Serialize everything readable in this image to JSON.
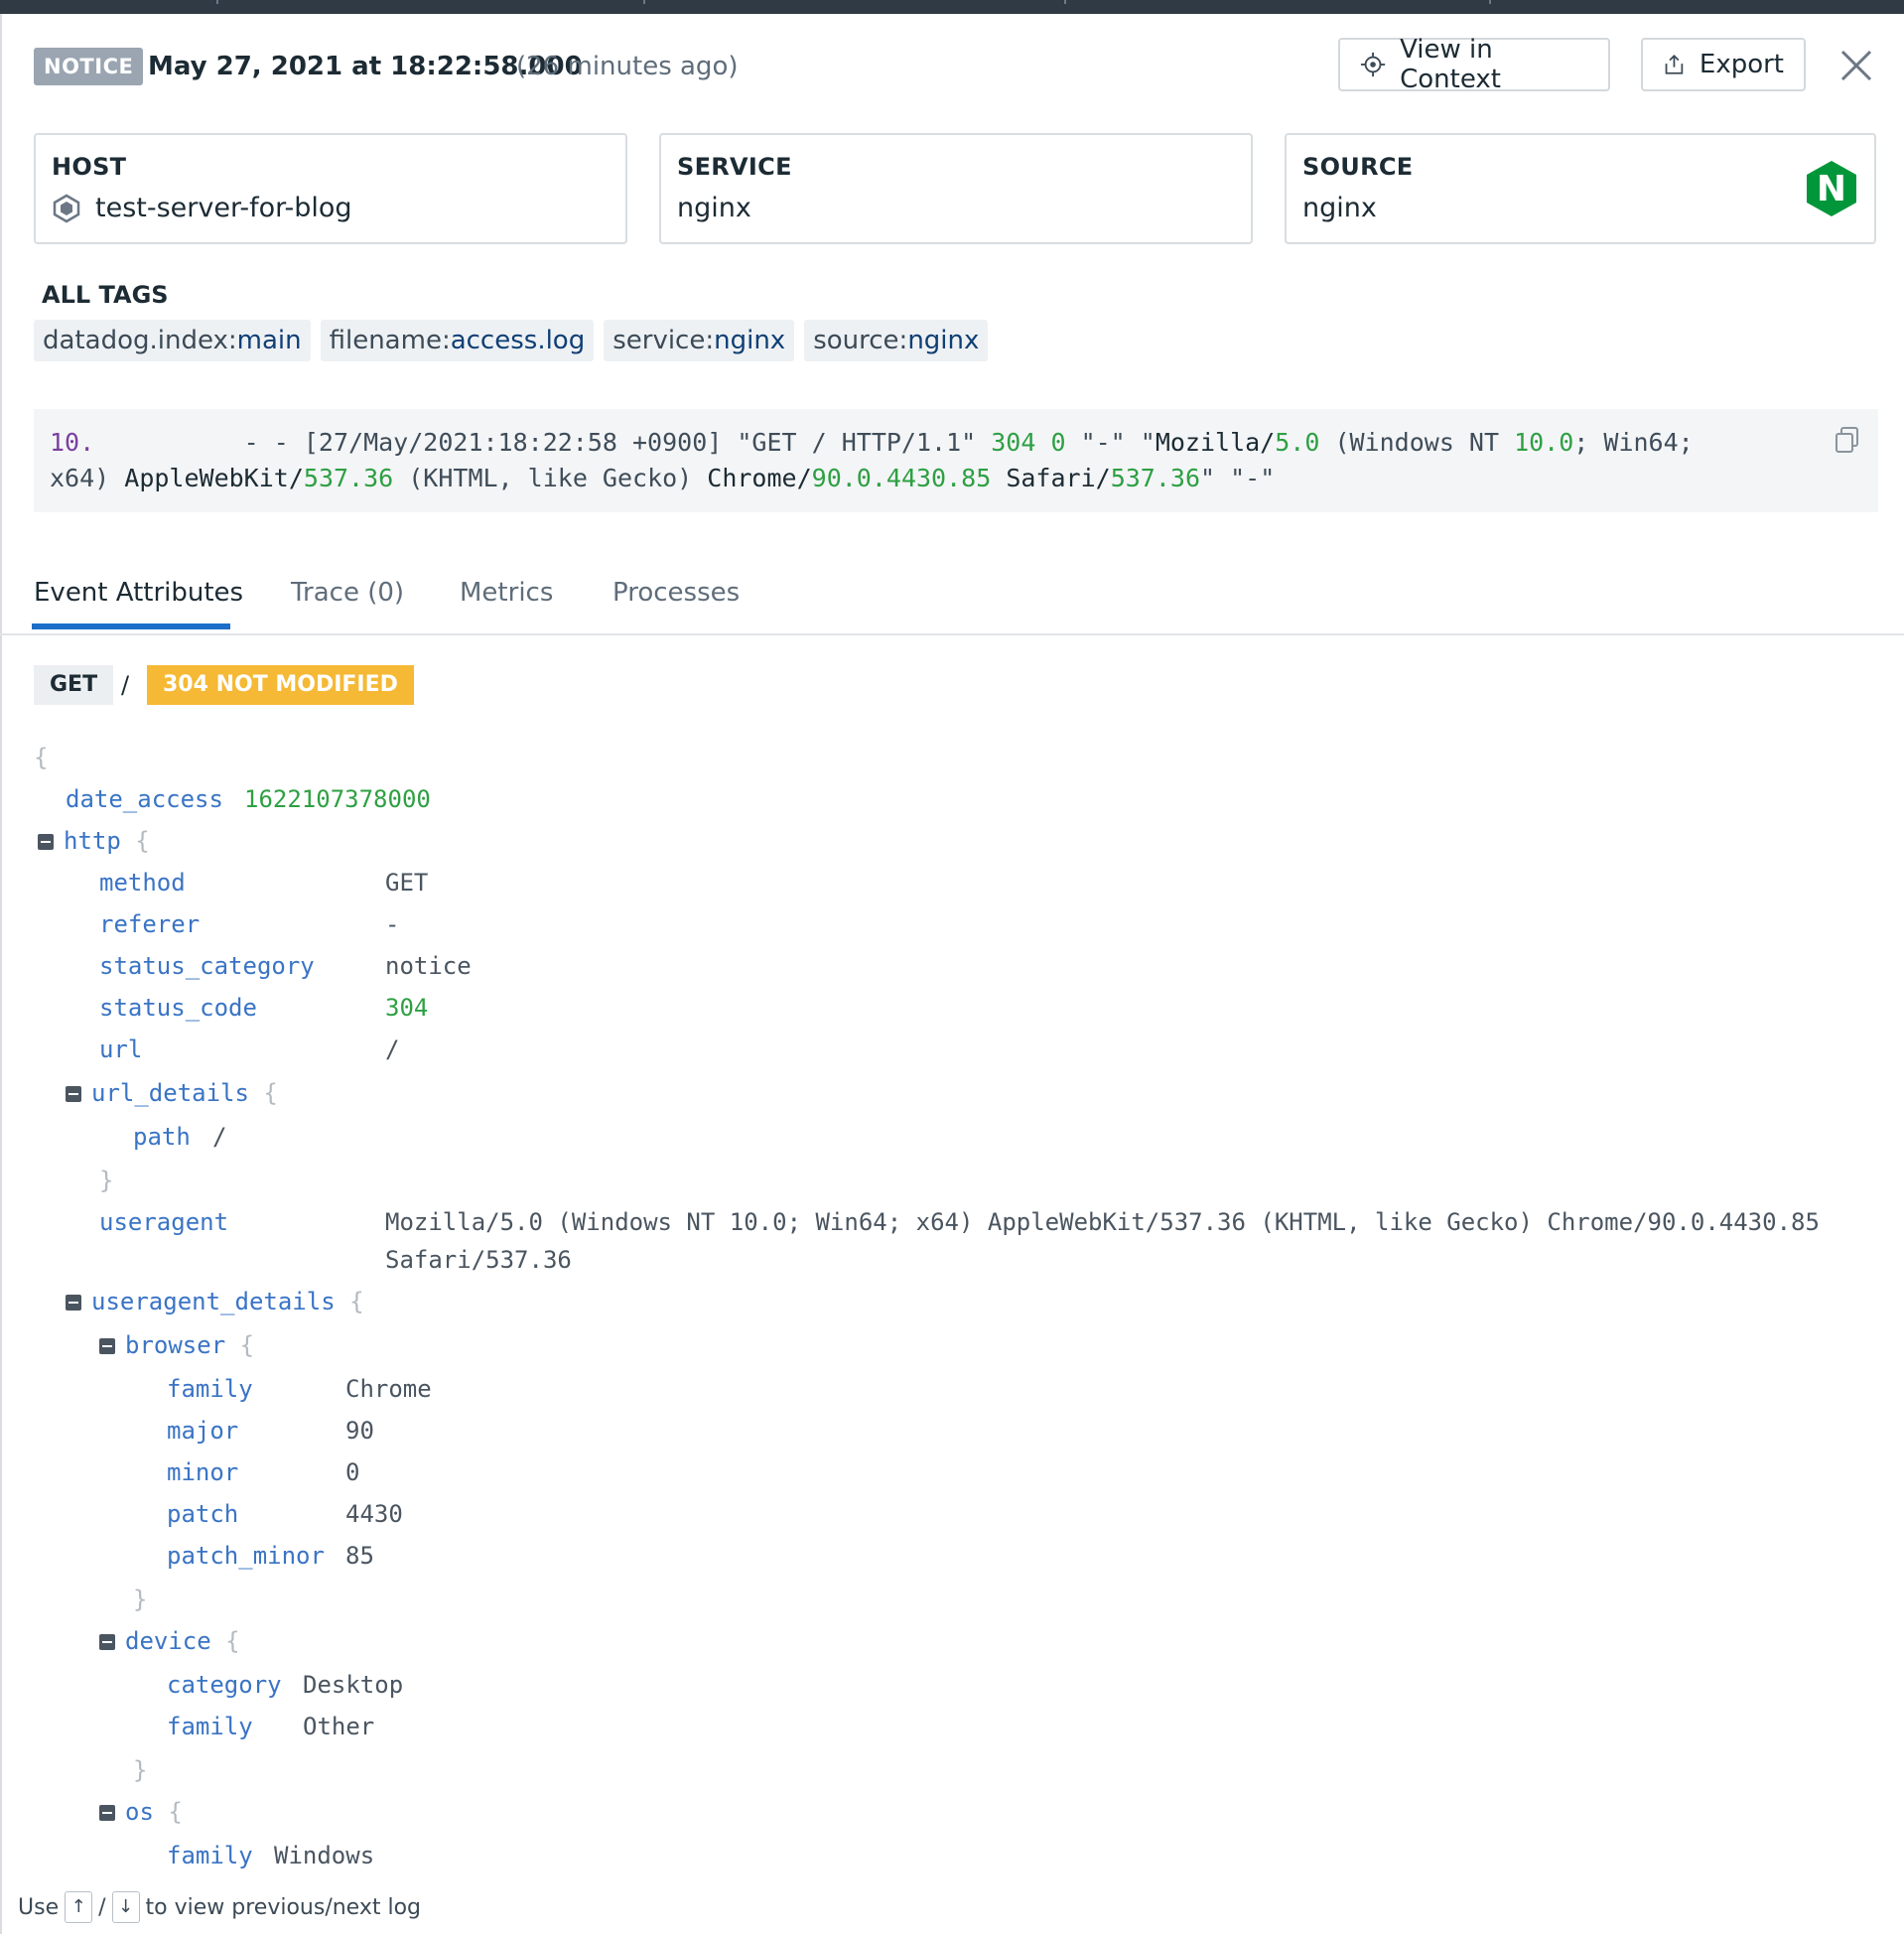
{
  "header": {
    "level": "NOTICE",
    "timestamp": "May 27, 2021 at 18:22:58.000",
    "relative_time": "(26 minutes ago)",
    "view_in_context_label": "View in Context",
    "export_label": "Export"
  },
  "cards": {
    "host": {
      "title": "HOST",
      "value": "test-server-for-blog"
    },
    "service": {
      "title": "SERVICE",
      "value": "nginx"
    },
    "source": {
      "title": "SOURCE",
      "value": "nginx",
      "logo_letter": "N",
      "logo_color": "#009639"
    }
  },
  "tags": {
    "title": "ALL TAGS",
    "items": [
      {
        "key": "datadog.index:",
        "value": "main"
      },
      {
        "key": "filename:",
        "value": "access.log"
      },
      {
        "key": "service:",
        "value": "nginx"
      },
      {
        "key": "source:",
        "value": "nginx"
      }
    ]
  },
  "raw_log": {
    "ip": "10.",
    "part1": "          - - [27/May/2021:18:22:58 +0900] \"GET / HTTP/1.1\" ",
    "status": "304",
    "sp": " ",
    "bytes": "0",
    "part2": " \"-\" \"",
    "moz": "Mozilla/",
    "moz_v": "5.0",
    "part3": " (Windows NT ",
    "nt_v": "10.0",
    "part4": "; Win64;",
    "line2a": "x64) ",
    "awk": "AppleWebKit/",
    "awk_v": "537.36",
    "part5": " (KHTML, like Gecko) ",
    "chrome": "Chrome/",
    "chrome_v": "90.0.4430.85",
    "sp2": " ",
    "safari": "Safari/",
    "safari_v": "537.36",
    "part6": "\" \"-\""
  },
  "tabs": [
    {
      "label": "Event Attributes",
      "active": true
    },
    {
      "label": "Trace (0)"
    },
    {
      "label": "Metrics"
    },
    {
      "label": "Processes"
    }
  ],
  "request": {
    "method": "GET",
    "path": "/",
    "status": "304 NOT MODIFIED",
    "status_color": "#f5b935"
  },
  "attributes": {
    "open_brace": "{",
    "date_access_key": "date_access",
    "date_access_value": "1622107378000",
    "http_key": "http",
    "http": {
      "method_key": "method",
      "method_value": "GET",
      "referer_key": "referer",
      "referer_value": "-",
      "status_category_key": "status_category",
      "status_category_value": "notice",
      "status_code_key": "status_code",
      "status_code_value": "304",
      "url_key": "url",
      "url_value": "/",
      "url_details_key": "url_details",
      "path_key": "path",
      "path_value": "/",
      "useragent_key": "useragent",
      "useragent_value_line1": "Mozilla/5.0 (Windows NT 10.0; Win64; x64) AppleWebKit/537.36 (KHTML, like Gecko) Chrome/90.0.4430.85",
      "useragent_value_line2": "Safari/537.36"
    },
    "useragent_details_key": "useragent_details",
    "browser_key": "browser",
    "browser": {
      "family_key": "family",
      "family_value": "Chrome",
      "major_key": "major",
      "major_value": "90",
      "minor_key": "minor",
      "minor_value": "0",
      "patch_key": "patch",
      "patch_value": "4430",
      "patch_minor_key": "patch_minor",
      "patch_minor_value": "85"
    },
    "device_key": "device",
    "device": {
      "category_key": "category",
      "category_value": "Desktop",
      "family_key": "family",
      "family_value": "Other"
    },
    "os_key": "os",
    "os": {
      "family_key": "family",
      "family_value": "Windows"
    }
  },
  "footer": {
    "use": "Use",
    "up": "↑",
    "sep": "/",
    "down": "↓",
    "rest": "to view previous/next log"
  },
  "icons": {
    "level": "notice-badge",
    "view_in_context": "crosshair-icon",
    "export": "export-icon",
    "close": "close-icon",
    "host": "hexagon-icon",
    "copy": "copy-icon",
    "toggle": "collapse-icon"
  }
}
